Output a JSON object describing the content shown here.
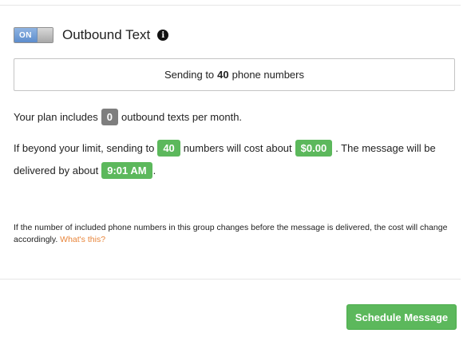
{
  "header": {
    "toggle_label": "ON",
    "title": "Outbound Text",
    "info_icon": "info-circle-icon"
  },
  "recipients": {
    "prefix": "Sending to",
    "count": "40",
    "suffix": "phone numbers"
  },
  "plan": {
    "prefix": "Your plan includes",
    "included": "0",
    "suffix": "outbound texts per month."
  },
  "cost": {
    "prefix": "If beyond your limit, sending to",
    "count": "40",
    "middle": "numbers will cost about",
    "amount": "$0.00",
    "suffix": ". The message will be"
  },
  "delivery": {
    "prefix": "delivered by about",
    "time": "9:01 AM",
    "suffix": "."
  },
  "note": {
    "text": "If the number of included phone numbers in this group changes before the message is delivered, the cost will change accordingly.",
    "link": "What's this?"
  },
  "actions": {
    "schedule_label": "Schedule Message"
  },
  "colors": {
    "accent_green": "#5cb85c",
    "toggle_blue": "#5d8dcd",
    "link_orange": "#e8853a",
    "badge_gray": "#7e7e7e"
  }
}
